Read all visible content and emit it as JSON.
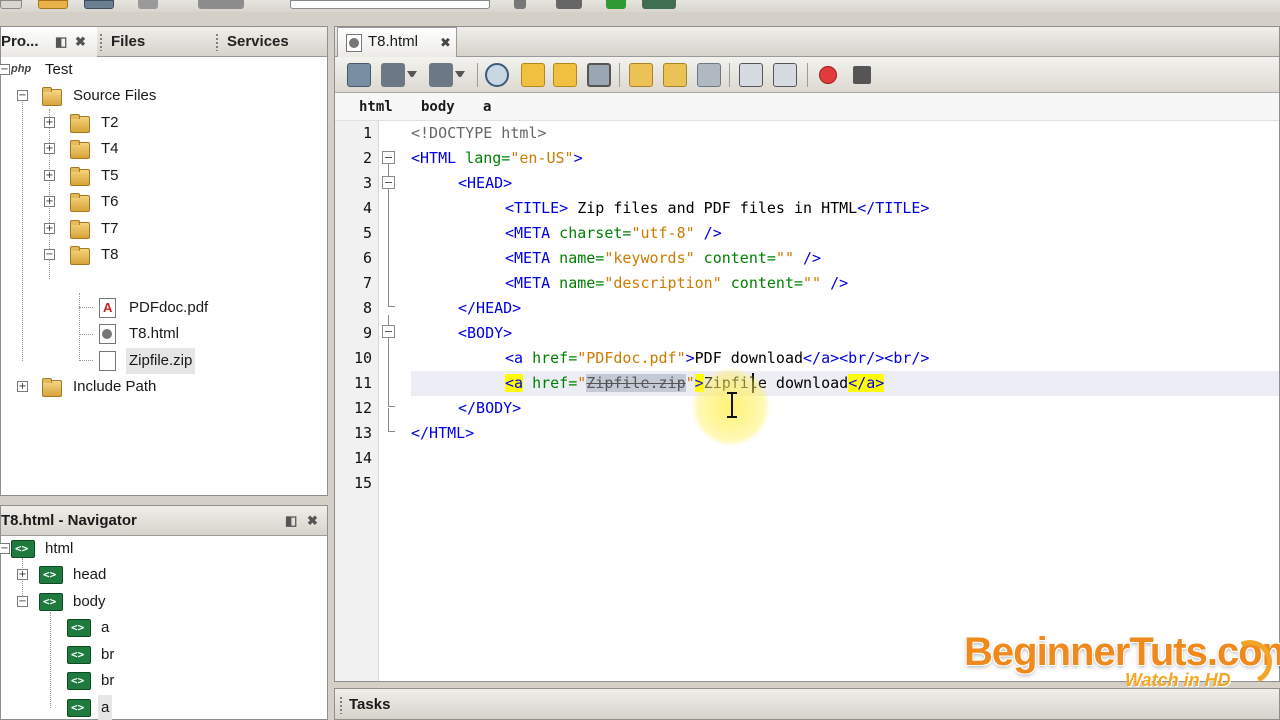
{
  "colors": {
    "tag": "#0000e6",
    "attribute": "#008000",
    "value": "#ce7b00",
    "highlight": "#ffff00",
    "watermark": "#f08a1c"
  },
  "project_panel": {
    "tabs": [
      {
        "label": "Pro...",
        "icons": [
          "restore-icon",
          "close-icon"
        ]
      },
      {
        "label": "Files"
      },
      {
        "label": "Services"
      }
    ],
    "tree": {
      "project": "Test",
      "source_files": "Source Files",
      "folders": [
        "T2",
        "T4",
        "T5",
        "T6",
        "T7",
        "T8"
      ],
      "t8_files": [
        "PDFdoc.pdf",
        "T8.html",
        "Zipfile.zip"
      ],
      "include_path": "Include Path",
      "project_badge": "php"
    }
  },
  "navigator": {
    "title": "T8.html - Navigator",
    "nodes": [
      "html",
      "head",
      "body",
      "a",
      "br",
      "br",
      "a"
    ]
  },
  "editor": {
    "tab_label": "T8.html",
    "breadcrumb": [
      "html",
      "body",
      "a"
    ],
    "line_numbers": [
      "1",
      "2",
      "3",
      "4",
      "5",
      "6",
      "7",
      "8",
      "9",
      "10",
      "11",
      "12",
      "13",
      "14",
      "15"
    ],
    "lines": {
      "l1": "<!DOCTYPE html>",
      "l2_tag": "<HTML",
      "l2_attr": " lang=",
      "l2_val": "\"en-US\"",
      "l2_end": ">",
      "l3": "<HEAD>",
      "l4_open": "<TITLE>",
      "l4_text": " Zip files and PDF files in HTML",
      "l4_close": "</TITLE>",
      "l5_tag": "<META",
      "l5_attr": " charset=",
      "l5_val": "\"utf-8\"",
      "l5_end": " />",
      "l6_tag": "<META",
      "l6_attr1": " name=",
      "l6_val1": "\"keywords\"",
      "l6_attr2": " content=",
      "l6_val2": "\"\"",
      "l6_end": " />",
      "l7_tag": "<META",
      "l7_attr1": " name=",
      "l7_val1": "\"description\"",
      "l7_attr2": " content=",
      "l7_val2": "\"\"",
      "l7_end": " />",
      "l8": "</HEAD>",
      "l9": "<BODY>",
      "l10_tag": "<a",
      "l10_attr": " href=",
      "l10_val": "\"PDFdoc.pdf\"",
      "l10_end": ">",
      "l10_text": "PDF download",
      "l10_close": "</a><br/><br/>",
      "l11_tag": "<a",
      "l11_attr": " href=",
      "l11_q1": "\"",
      "l11_sel": "Zipfile.zip",
      "l11_q2": "\"",
      "l11_end": ">",
      "l11_text": "Zipfile download",
      "l11_close": "</a>",
      "l12": "</BODY>",
      "l13": "</HTML>"
    }
  },
  "tasks_panel": {
    "label": "Tasks"
  },
  "watermark": {
    "main": "BeginnerTuts.com",
    "sub": "Watch in HD"
  }
}
